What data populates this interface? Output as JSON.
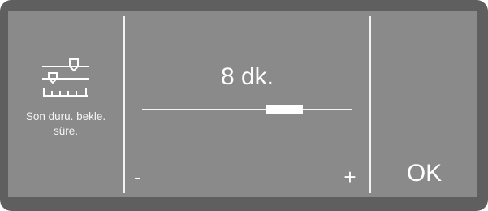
{
  "setting": {
    "icon": "slider-settings-icon",
    "label": "Son duru. bekle.\nsüre."
  },
  "value": {
    "display": "8 dk.",
    "slider_level_fraction": 0.68
  },
  "controls": {
    "minus_label": "-",
    "plus_label": "+",
    "ok_label": "OK"
  },
  "colors": {
    "bezel": "#5f5f5f",
    "screen": "#8a8a8a",
    "foreground": "#ffffff"
  }
}
